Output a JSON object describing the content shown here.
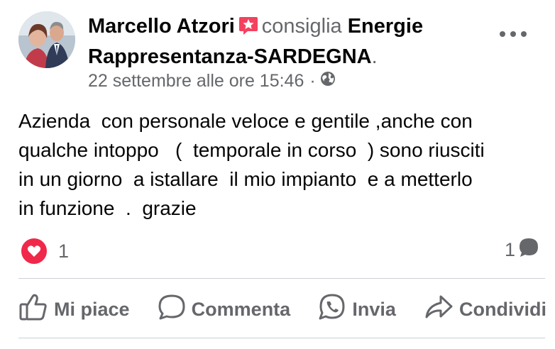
{
  "post": {
    "author": "Marcello Atzori",
    "verb": "consiglia",
    "page_name": "Energie Rappresentanza-SARDEGNA",
    "period": ".",
    "timestamp": "22 settembre alle ore 15:46",
    "separator": "·",
    "privacy_icon": "globe-icon",
    "body": "Azienda  con personale veloce e gentile ,anche con\nqualche intoppo   (  temporale in corso  ) sono riusciti\nin un giorno  a istallare  il mio impianto  e a metterlo\nin funzione  .  grazie"
  },
  "stats": {
    "reaction_icon": "love-reaction-icon",
    "reaction_count": "1",
    "comment_count": "1"
  },
  "actions": {
    "like": "Mi piace",
    "comment": "Commenta",
    "send": "Invia",
    "share": "Condividi"
  },
  "colors": {
    "text": "#050505",
    "secondary": "#65676b",
    "love": "#f0284a",
    "recommend": "#f3425f",
    "divider": "#ced0d4"
  }
}
